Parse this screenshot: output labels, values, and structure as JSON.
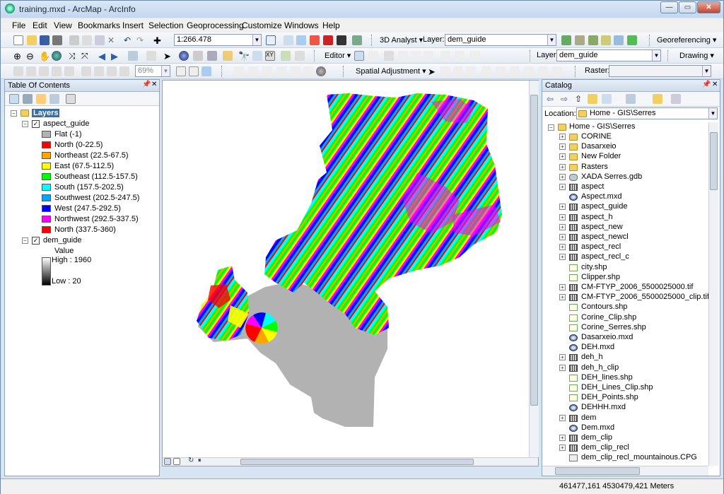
{
  "window": {
    "title": "training.mxd - ArcMap - ArcInfo"
  },
  "menu": [
    "File",
    "Edit",
    "View",
    "Bookmarks",
    "Insert",
    "Selection",
    "Geoprocessing",
    "Customize",
    "Windows",
    "Help"
  ],
  "toolbar": {
    "scale": "1:266.478",
    "analyst_label": "3D Analyst",
    "layer_label": "Layer:",
    "layer_value": "dem_guide",
    "georef_label": "Georeferencing",
    "editor_label": "Editor",
    "layer2_label": "Layer:",
    "layer2_value": "dem_guide",
    "drawing_label": "Drawing",
    "zoom_pct": "69%",
    "spatial_adj_label": "Spatial Adjustment",
    "raster_label": "Raster:"
  },
  "toc": {
    "title": "Table Of Contents",
    "root": "Layers",
    "layer1": "aspect_guide",
    "legend": [
      {
        "label": "Flat (-1)",
        "color": "#b2b2b2"
      },
      {
        "label": "North (0-22.5)",
        "color": "#ff0000"
      },
      {
        "label": "Northeast (22.5-67.5)",
        "color": "#ffa500"
      },
      {
        "label": "East (67.5-112.5)",
        "color": "#ffff00"
      },
      {
        "label": "Southeast (112.5-157.5)",
        "color": "#00ff00"
      },
      {
        "label": "South (157.5-202.5)",
        "color": "#00ffff"
      },
      {
        "label": "Southwest (202.5-247.5)",
        "color": "#00a6ff"
      },
      {
        "label": "West (247.5-292.5)",
        "color": "#0000ff"
      },
      {
        "label": "Northwest (292.5-337.5)",
        "color": "#ff00ff"
      },
      {
        "label": "North (337.5-360)",
        "color": "#ff0000"
      }
    ],
    "layer2": "dem_guide",
    "value_label": "Value",
    "high": "High : 1960",
    "low": "Low : 20"
  },
  "catalog": {
    "title": "Catalog",
    "location_label": "Location:",
    "location_value": "Home - GIS\\Serres",
    "root": "Home - GIS\\Serres",
    "items": [
      {
        "name": "CORINE",
        "type": "folder",
        "exp": true
      },
      {
        "name": "Dasarxeio",
        "type": "folder",
        "exp": true
      },
      {
        "name": "New Folder",
        "type": "folder",
        "exp": true
      },
      {
        "name": "Rasters",
        "type": "folder",
        "exp": true
      },
      {
        "name": "XADA Serres.gdb",
        "type": "gdb",
        "exp": true
      },
      {
        "name": "aspect",
        "type": "rast",
        "exp": true
      },
      {
        "name": "Aspect.mxd",
        "type": "mxd",
        "exp": false
      },
      {
        "name": "aspect_guide",
        "type": "rast",
        "exp": true
      },
      {
        "name": "aspect_h",
        "type": "rast",
        "exp": true
      },
      {
        "name": "aspect_new",
        "type": "rast",
        "exp": true
      },
      {
        "name": "aspect_newcl",
        "type": "rast",
        "exp": true
      },
      {
        "name": "aspect_recl",
        "type": "rast",
        "exp": true
      },
      {
        "name": "aspect_recl_c",
        "type": "rast",
        "exp": true
      },
      {
        "name": "city.shp",
        "type": "shp",
        "exp": false
      },
      {
        "name": "Clipper.shp",
        "type": "shp",
        "exp": false
      },
      {
        "name": "CM-FTYP_2006_5500025000.tif",
        "type": "rast",
        "exp": true
      },
      {
        "name": "CM-FTYP_2006_5500025000_clip.tif",
        "type": "rast",
        "exp": true
      },
      {
        "name": "Contours.shp",
        "type": "shp",
        "exp": false
      },
      {
        "name": "Corine_Clip.shp",
        "type": "shp",
        "exp": false
      },
      {
        "name": "Corine_Serres.shp",
        "type": "shp",
        "exp": false
      },
      {
        "name": "Dasarxeio.mxd",
        "type": "mxd",
        "exp": false
      },
      {
        "name": "DEH.mxd",
        "type": "mxd",
        "exp": false
      },
      {
        "name": "deh_h",
        "type": "rast",
        "exp": true
      },
      {
        "name": "deh_h_clip",
        "type": "rast",
        "exp": true
      },
      {
        "name": "DEH_lines.shp",
        "type": "shp",
        "exp": false
      },
      {
        "name": "DEH_Lines_Clip.shp",
        "type": "shp",
        "exp": false
      },
      {
        "name": "DEH_Points.shp",
        "type": "shp",
        "exp": false
      },
      {
        "name": "DEHHH.mxd",
        "type": "mxd",
        "exp": false
      },
      {
        "name": "dem",
        "type": "rast",
        "exp": true
      },
      {
        "name": "Dem.mxd",
        "type": "mxd",
        "exp": false
      },
      {
        "name": "dem_clip",
        "type": "rast",
        "exp": true
      },
      {
        "name": "dem_clip_recl",
        "type": "rast",
        "exp": true
      },
      {
        "name": "dem_clip_recl_mountainous.CPG",
        "type": "cpg",
        "exp": false
      }
    ]
  },
  "status": {
    "coords": "461477,161  4530479,421 Meters"
  }
}
